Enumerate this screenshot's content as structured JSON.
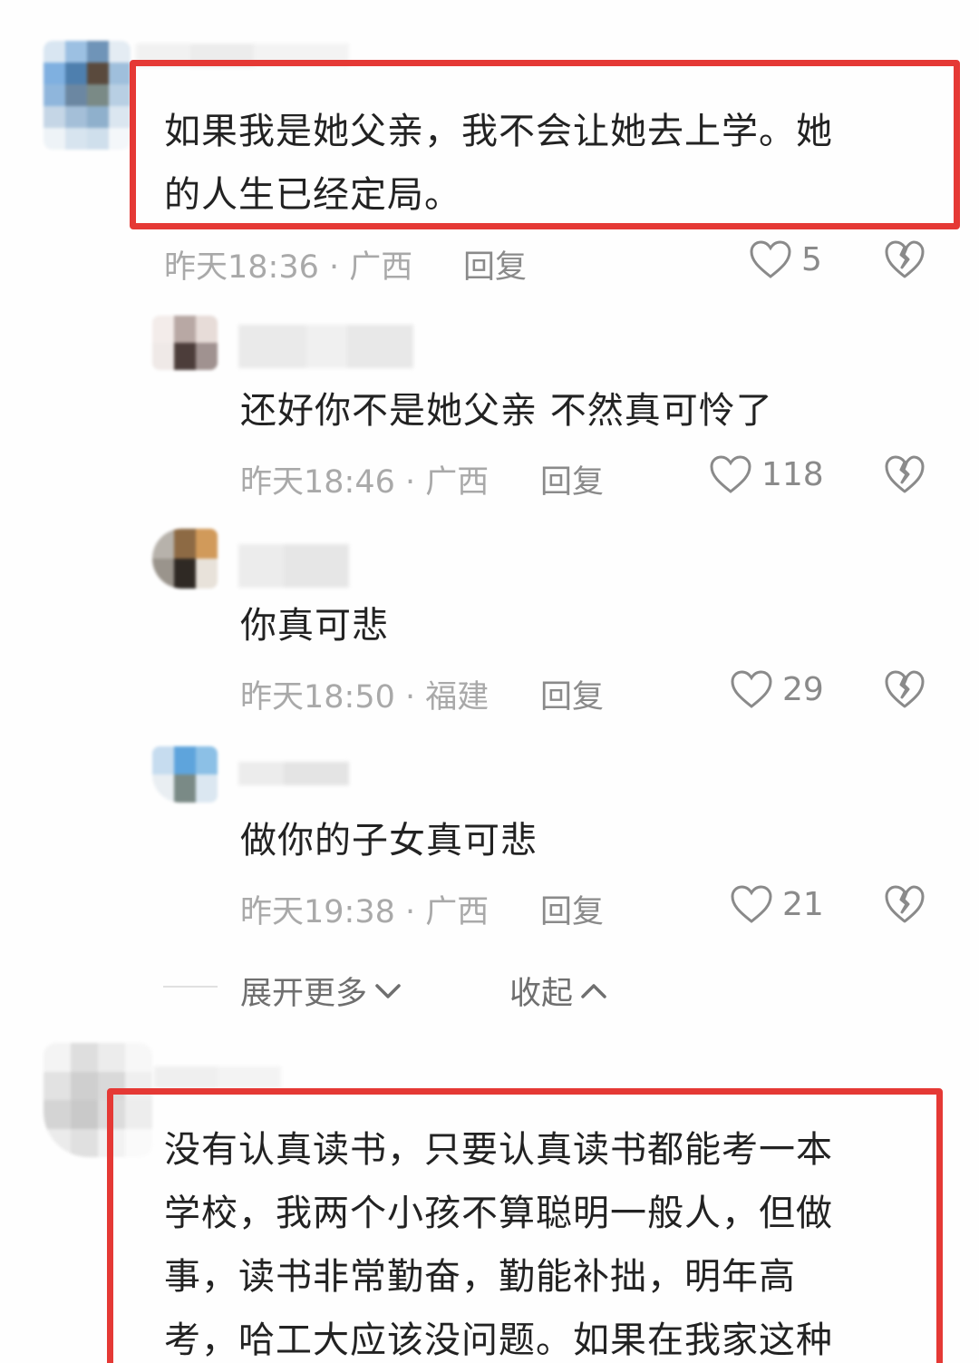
{
  "comments": [
    {
      "text_lines": [
        "如果我是她父亲，我不会让她去上学。她",
        "的人生已经定局。"
      ],
      "meta": "昨天18:36 · 广西",
      "reply_label": "回复",
      "likes": "5"
    },
    {
      "text_lines": [
        "还好你不是她父亲 不然真可怜了"
      ],
      "meta": "昨天18:46 · 广西",
      "reply_label": "回复",
      "likes": "118"
    },
    {
      "text_lines": [
        "你真可悲"
      ],
      "meta": "昨天18:50 · 福建",
      "reply_label": "回复",
      "likes": "29"
    },
    {
      "text_lines": [
        "做你的子女真可悲"
      ],
      "meta": "昨天19:38 · 广西",
      "reply_label": "回复",
      "likes": "21"
    },
    {
      "text_lines": [
        "没有认真读书，只要认真读书都能考一本",
        "学校，我两个小孩不算聪明一般人，但做",
        "事，读书非常勤奋，勤能补拙，明年高",
        "考，哈工大应该没问题。如果在我家这种"
      ]
    }
  ],
  "thread_controls": {
    "expand_label": "展开更多",
    "collapse_label": "收起"
  },
  "colors": {
    "highlight_border": "#e53935",
    "meta_text": "#a9a9a9",
    "body_text": "#222222"
  }
}
